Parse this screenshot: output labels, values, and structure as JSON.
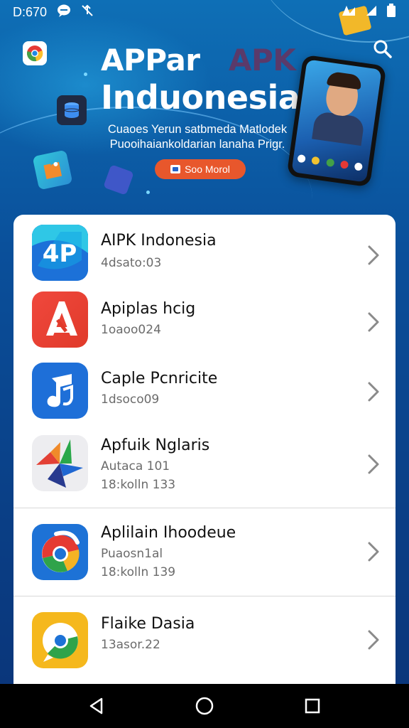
{
  "status_bar": {
    "time": "D:670",
    "left_icons": [
      "messenger-icon",
      "mute-icon"
    ],
    "right_icons": [
      "signal-icon",
      "wifi-icon",
      "battery-icon"
    ]
  },
  "hero": {
    "title_line1": "APPar",
    "title_brand": "APK",
    "title_line2": "Induonesia",
    "tagline": "Cuaoes Yerun satbmeda Matlodek Puooihaiankoldarian lanaha Prigr.",
    "button_label": "Soo Morol"
  },
  "apps": [
    {
      "name": "AIPK Indonesia",
      "meta": [
        "4dsato:03"
      ],
      "icon": "ap-logo-icon"
    },
    {
      "name": "Apiplas hcig",
      "meta": [
        "1oaoo024"
      ],
      "icon": "red-a-logo-icon"
    },
    {
      "name": "Caple Pcnricite",
      "meta": [
        "1dsoco09"
      ],
      "icon": "music-note-icon"
    },
    {
      "name": "Apfuik Nglaris",
      "meta": [
        "Autaca 101",
        "18:kolln 133"
      ],
      "icon": "pinwheel-icon"
    },
    {
      "name": "Aplilain Ihoodeue",
      "meta": [
        "Puaosn1al",
        "18:kolln 139"
      ],
      "icon": "chrome-blue-icon"
    },
    {
      "name": "Flaike Dasia",
      "meta": [
        "13asor.22"
      ],
      "icon": "chrome-yellow-icon"
    }
  ],
  "colors": {
    "accent_orange": "#e8572c",
    "hero_blue": "#0e6fb6",
    "card_bg": "#ffffff"
  },
  "nav_bar": {
    "buttons": [
      "back-icon",
      "home-icon",
      "recents-icon"
    ]
  }
}
